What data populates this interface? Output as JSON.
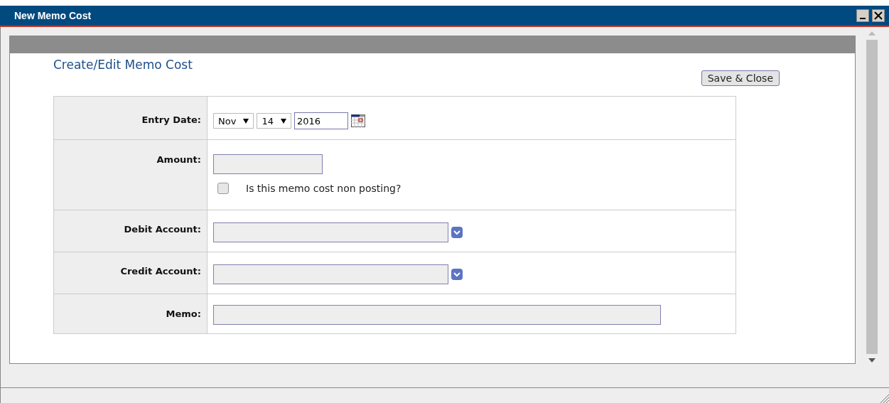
{
  "window": {
    "title": "New Memo Cost"
  },
  "form": {
    "heading": "Create/Edit Memo Cost",
    "save_button": "Save & Close",
    "rows": [
      {
        "kind": "date",
        "label": "Entry Date:",
        "month": "Nov",
        "day": "14",
        "year": "2016"
      },
      {
        "kind": "amount",
        "label": "Amount:",
        "checkbox_label": "Is this memo cost non posting?",
        "checked": false
      },
      {
        "kind": "account",
        "label": "Debit Account:"
      },
      {
        "kind": "account",
        "label": "Credit Account:"
      },
      {
        "kind": "memo",
        "label": "Memo:"
      }
    ]
  }
}
